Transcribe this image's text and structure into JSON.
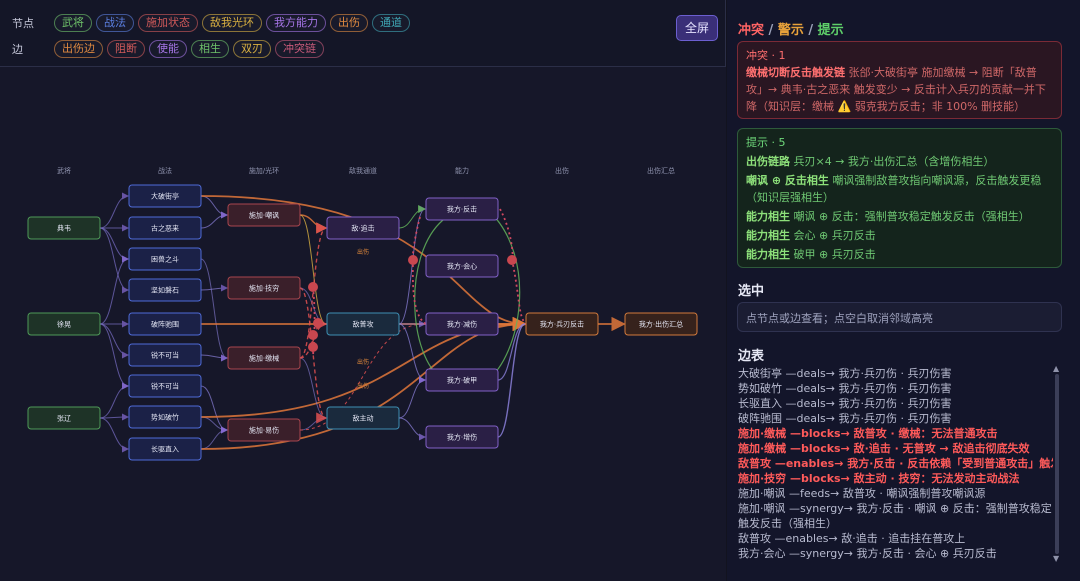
{
  "filters": {
    "node_label": "节点",
    "edge_label": "边",
    "node_chips": [
      {
        "label": "武将",
        "color": "#6fc36a"
      },
      {
        "label": "战法",
        "color": "#5b7fe0"
      },
      {
        "label": "施加状态",
        "color": "#d25a5a"
      },
      {
        "label": "敌我光环",
        "color": "#d9b041"
      },
      {
        "label": "我方能力",
        "color": "#a575e6"
      },
      {
        "label": "出伤",
        "color": "#e08a40"
      },
      {
        "label": "通道",
        "color": "#3fa7b5"
      }
    ],
    "edge_chips": [
      {
        "label": "出伤边",
        "color": "#e08a40"
      },
      {
        "label": "阻断",
        "color": "#d25a5a"
      },
      {
        "label": "使能",
        "color": "#a575e6"
      },
      {
        "label": "相生",
        "color": "#6fc36a"
      },
      {
        "label": "双刃",
        "color": "#d9b041"
      },
      {
        "label": "冲突链",
        "color": "#c85a7a"
      }
    ]
  },
  "fullscreen_label": "全屏",
  "graph": {
    "columns": [
      "武将",
      "战法",
      "施加/光环",
      "敌我通道",
      "能力",
      "出伤",
      "出伤汇总"
    ],
    "edge_labels": [
      "出伤",
      "出伤",
      "出伤"
    ],
    "nodes": {
      "dianwei": "典韦",
      "xuhuang": "徐晃",
      "zhangliao": "张辽",
      "dapo": "大破街亭",
      "guzhie": "古之恶来",
      "kunshou": "困兽之斗",
      "jianrou": "坚如磐石",
      "pozhen": "破阵驰围",
      "yongbu": "锐不可当",
      "ruibu": "锐不可当",
      "shijia": "势如破竹",
      "changqu": "长驱直入",
      "sj_chaofeng": "施加·嘲讽",
      "sj_jiqiong": "施加·技穷",
      "sj_jiaoxie": "施加·缴械",
      "sj_jingshang": "施加·易伤",
      "di_zhuiji": "敌·追击",
      "di_pugong": "敌普攻",
      "di_zhudong": "敌主动",
      "wo_fanji": "我方·反击",
      "wo_huixin": "我方·会心",
      "wo_jianshang": "我方·减伤",
      "wo_pojia": "我方·破甲",
      "wo_zengshang": "我方·增伤",
      "wo_bingren": "我方·兵刃反击",
      "wo_huizong": "我方·出伤汇总"
    }
  },
  "panel": {
    "warn_title": {
      "conflict": "冲突",
      "warning": "警示",
      "hint": "提示",
      "sep": " / "
    },
    "conflict": {
      "header": "冲突 · 1",
      "bold": "缴械切断反击触发链",
      "text": " 张郃·大破街亭 施加缴械 → 阻断「敌普攻」→ 典韦·古之恶来 触发变少 → 反击计入兵刃的贡献一并下降（知识层：缴械 ⚠️ 弱克我方反击；非 100% 删技能）"
    },
    "hints": {
      "header": "提示 · 5",
      "items": [
        {
          "bold": "出伤链路",
          "text": " 兵刃×4 → 我方·出伤汇总（含增伤相生）"
        },
        {
          "bold": "嘲讽 ⊕ 反击相生",
          "text": " 嘲讽强制敌普攻指向嘲讽源，反击触发更稳（知识层强相生）"
        },
        {
          "bold": "能力相生",
          "text": " 嘲讽 ⊕ 反击：强制普攻稳定触发反击（强相生）"
        },
        {
          "bold": "能力相生",
          "text": " 会心 ⊕ 兵刃反击"
        },
        {
          "bold": "能力相生",
          "text": " 破甲 ⊕ 兵刃反击"
        }
      ]
    },
    "selected": {
      "title": "选中",
      "placeholder": "点节点或边查看；点空白取消邻域高亮"
    },
    "edges": {
      "title": "边表",
      "items": [
        {
          "text": "大破街亭 —deals→ 我方·兵刃伤 · 兵刃伤害",
          "hi": false
        },
        {
          "text": "势如破竹 —deals→ 我方·兵刃伤 · 兵刃伤害",
          "hi": false
        },
        {
          "text": "长驱直入 —deals→ 我方·兵刃伤 · 兵刃伤害",
          "hi": false
        },
        {
          "text": "破阵驰围 —deals→ 我方·兵刃伤 · 兵刃伤害",
          "hi": false
        },
        {
          "text": "施加·缴械 —blocks→ 敌普攻 · 缴械：无法普通攻击",
          "hi": true
        },
        {
          "text": "施加·缴械 —blocks→ 敌·追击 · 无普攻 → 敌追击彻底失效",
          "hi": true
        },
        {
          "text": "敌普攻 —enables→ 我方·反击 · 反击依赖「受到普通攻击」触发",
          "hi": true
        },
        {
          "text": "施加·技穷 —blocks→ 敌主动 · 技穷：无法发动主动战法",
          "hi": true
        },
        {
          "text": "施加·嘲讽 —feeds→ 敌普攻 · 嘲讽强制普攻嘲讽源",
          "hi": false
        },
        {
          "text": "施加·嘲讽 —synergy→ 我方·反击 · 嘲讽 ⊕ 反击：强制普攻稳定触发反击（强相生）",
          "hi": false,
          "wrap": true
        },
        {
          "text": "敌普攻 —enables→ 敌·追击 · 追击挂在普攻上",
          "hi": false
        },
        {
          "text": "我方·会心 —synergy→ 我方·反击 · 会心 ⊕ 兵刃反击",
          "hi": false
        }
      ]
    }
  }
}
